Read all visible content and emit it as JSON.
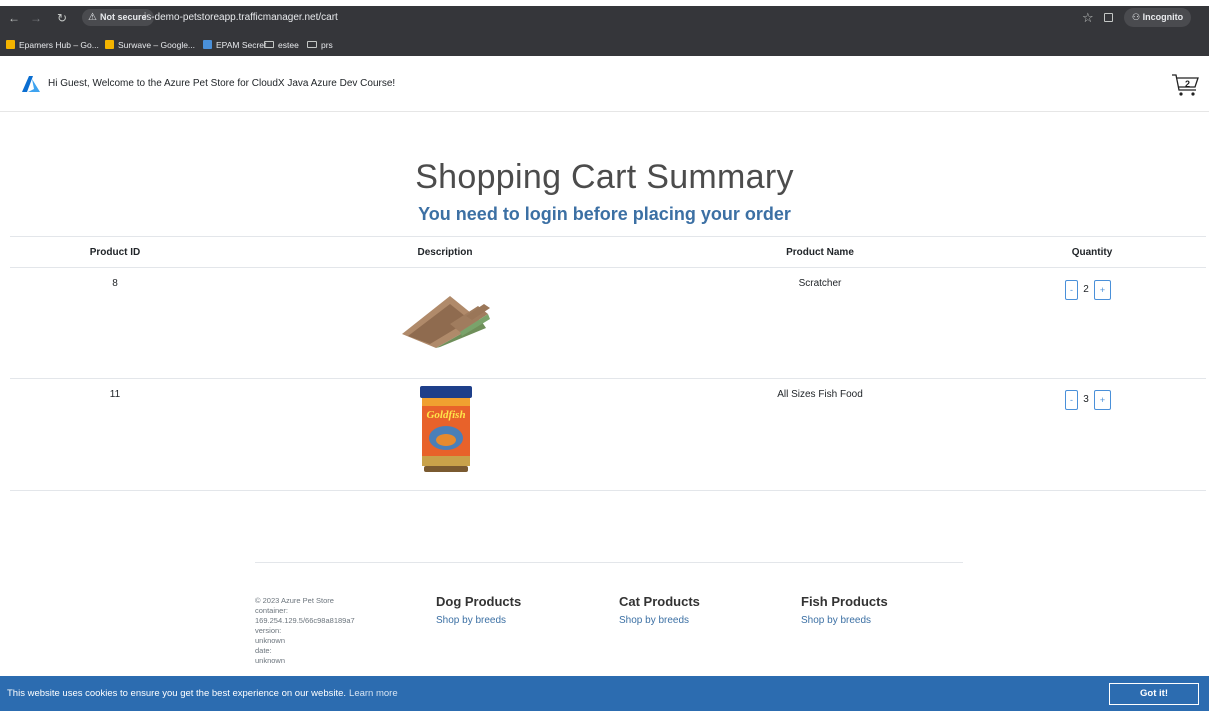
{
  "browser": {
    "secure_label": "Not secure",
    "url": "is-demo-petstoreapp.trafficmanager.net/cart",
    "incognito_label": "Incognito",
    "bookmarks": [
      {
        "label": "Epamers Hub – Go...",
        "icon": "drive-icon",
        "color": "#f4b400"
      },
      {
        "label": "Surwave – Google...",
        "icon": "drive-icon",
        "color": "#f4b400"
      },
      {
        "label": "EPAM Secret",
        "icon": "epam-icon",
        "color": "#4a90d9"
      },
      {
        "label": "estee",
        "icon": "folder-icon"
      },
      {
        "label": "prs",
        "icon": "folder-icon"
      }
    ]
  },
  "header": {
    "welcome": "Hi Guest, Welcome to the Azure Pet Store for CloudX Java Azure Dev Course!",
    "cart_count": "2"
  },
  "main": {
    "title": "Shopping Cart Summary",
    "login_message": "You need to login before placing your order",
    "columns": [
      "Product ID",
      "Description",
      "Product Name",
      "Quantity"
    ],
    "rows": [
      {
        "product_id": "8",
        "image": "scratcher-image",
        "product_name": "Scratcher",
        "quantity": "2",
        "minus": "-",
        "plus": "+"
      },
      {
        "product_id": "11",
        "image": "fish-food-image",
        "product_name": "All Sizes Fish Food",
        "quantity": "3",
        "minus": "-",
        "plus": "+"
      }
    ]
  },
  "footer": {
    "info": [
      "© 2023 Azure Pet Store",
      "container:",
      "169.254.129.5/66c98a8189a7",
      "version:",
      "unknown",
      "date:",
      "unknown"
    ],
    "columns": [
      {
        "heading": "Dog Products",
        "link": "Shop by breeds"
      },
      {
        "heading": "Cat Products",
        "link": "Shop by breeds"
      },
      {
        "heading": "Fish Products",
        "link": "Shop by breeds"
      }
    ]
  },
  "cookie": {
    "text": "This website uses cookies to ensure you get the best experience on our website.",
    "learn_more": "Learn more",
    "button": "Got it!"
  },
  "colors": {
    "accent": "#3c70a4",
    "banner": "#2c6cb0",
    "chrome": "#35363a"
  }
}
